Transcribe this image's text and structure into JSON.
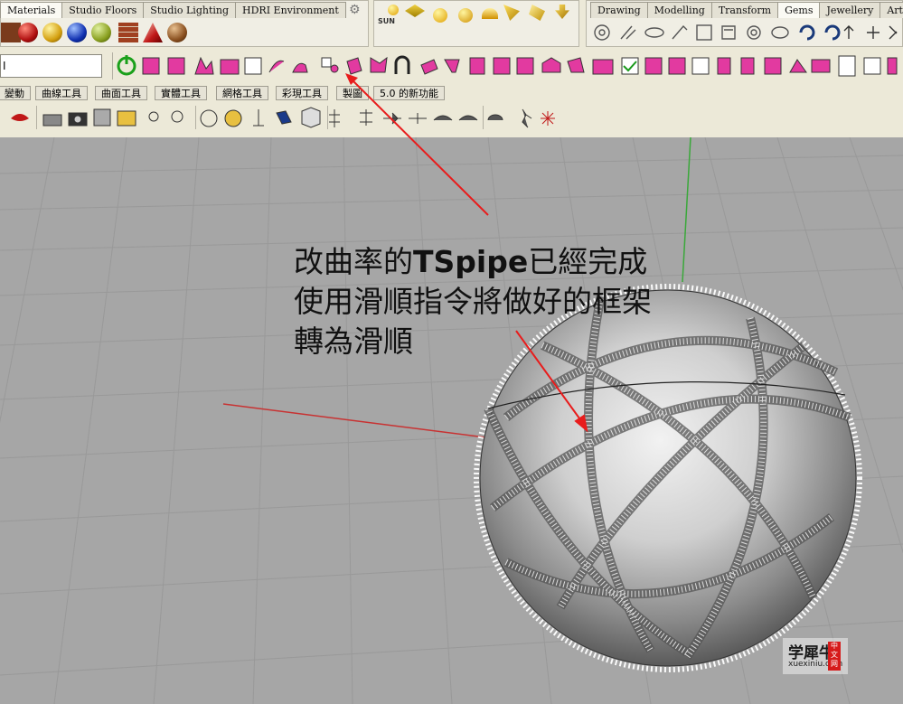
{
  "render_tabs": [
    "Materials",
    "Studio Floors",
    "Studio Lighting",
    "HDRI Environment"
  ],
  "light_panel": {
    "sun_label": "SUN"
  },
  "plugin_tabs": [
    "Drawing",
    "Modelling",
    "Transform",
    "Gems",
    "Jewellery",
    "Artistics"
  ],
  "plugin_active_tab": "Gems",
  "command_input": {
    "value": "I"
  },
  "command_tabs": [
    "變動",
    "曲線工具",
    "曲面工具",
    "實體工具",
    "網格工具",
    "彩現工具",
    "製圖",
    "5.0 的新功能"
  ],
  "annotation": {
    "line1_pre": "改曲率的",
    "line1_bold": "TSpipe",
    "line1_post": "已經完成",
    "line2": "使用滑順指令將做好的框架",
    "line3": "轉為滑順"
  },
  "colors": {
    "arrow": "#e81c1c",
    "axis_x": "#c83232",
    "axis_y": "#3aa83a",
    "grid": "#9a9a9a",
    "viewport": "#a6a6a6"
  },
  "watermark": {
    "title": "学犀牛",
    "url": "xuexiniu.com",
    "badge": "中文网"
  }
}
